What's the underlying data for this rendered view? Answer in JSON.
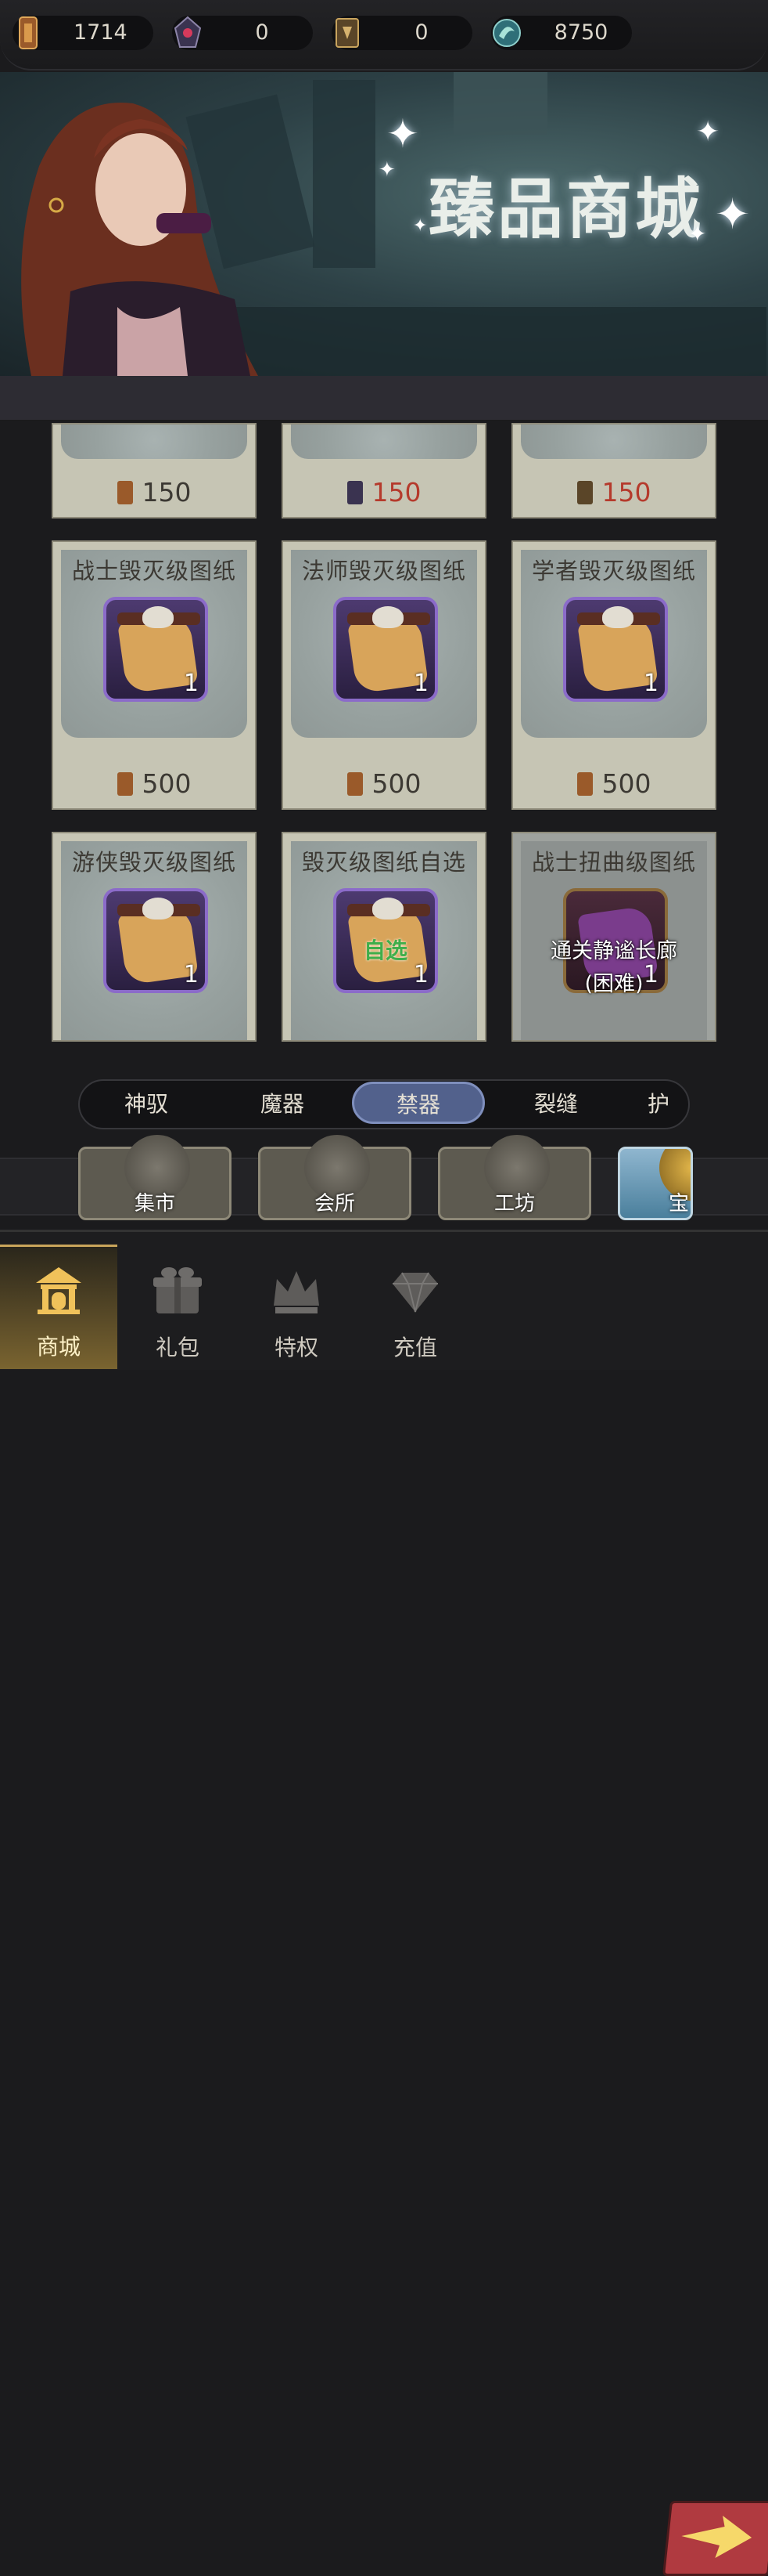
{
  "resources": [
    {
      "icon": "brown-scroll-icon",
      "value": "1714"
    },
    {
      "icon": "dark-crystal-icon",
      "value": "0"
    },
    {
      "icon": "spellbook-icon",
      "value": "0"
    },
    {
      "icon": "dragon-orb-icon",
      "value": "8750"
    }
  ],
  "banner": {
    "title": "臻品商城"
  },
  "top_prices": [
    {
      "currency": "brown-scroll-icon",
      "price": "150",
      "red": false
    },
    {
      "currency": "dark-crystal-icon",
      "price": "150",
      "red": true
    },
    {
      "currency": "spellbook-icon",
      "price": "150",
      "red": true
    }
  ],
  "items": [
    {
      "title": "战士毁灭级图纸",
      "qty": "1",
      "price": "500"
    },
    {
      "title": "法师毁灭级图纸",
      "qty": "1",
      "price": "500"
    },
    {
      "title": "学者毁灭级图纸",
      "qty": "1",
      "price": "500"
    },
    {
      "title": "游侠毁灭级图纸",
      "qty": "1"
    },
    {
      "title": "毁灭级图纸自选",
      "qty": "1",
      "tag": "自选"
    },
    {
      "title": "战士扭曲级图纸",
      "qty": "1",
      "lock_line1": "通关静谧长廊",
      "lock_line2": "(困难)"
    }
  ],
  "tabs": [
    "神驭",
    "魔器",
    "禁器",
    "裂缝",
    "护"
  ],
  "active_tab": "禁器",
  "categories": [
    "集市",
    "会所",
    "工坊",
    "宝"
  ],
  "nav": [
    "商城",
    "礼包",
    "特权",
    "充值"
  ],
  "colors": {
    "accent": "#52618c",
    "price_red": "#b53a2c",
    "nav_active": "#c9a55a"
  }
}
